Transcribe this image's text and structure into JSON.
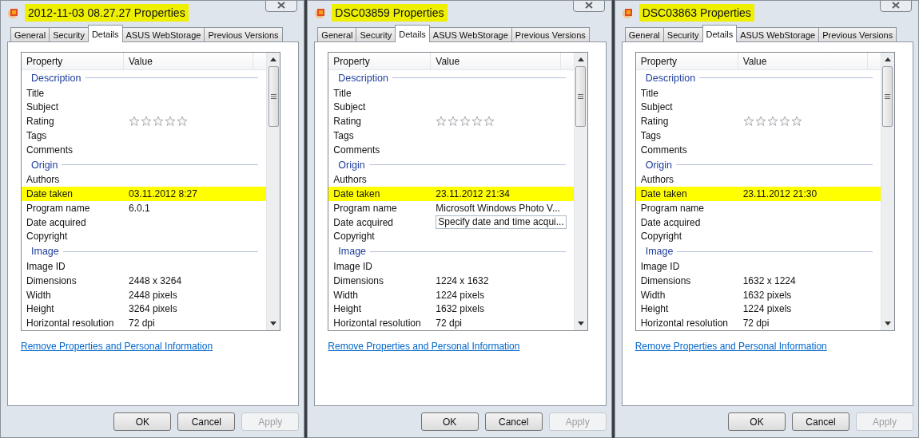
{
  "dialogs": [
    {
      "title": "2012-11-03 08.27.27 Properties",
      "title_highlighted": true,
      "tabs": [
        {
          "label": "General",
          "selected": false
        },
        {
          "label": "Security",
          "selected": false
        },
        {
          "label": "Details",
          "selected": true
        },
        {
          "label": "ASUS WebStorage",
          "selected": false
        },
        {
          "label": "Previous Versions",
          "selected": false
        }
      ],
      "columns": [
        "Property",
        "Value"
      ],
      "rows": [
        {
          "kind": "section",
          "name": "Description"
        },
        {
          "kind": "property",
          "name": "Title"
        },
        {
          "kind": "property",
          "name": "Subject"
        },
        {
          "kind": "rating",
          "name": "Rating",
          "stars": 0
        },
        {
          "kind": "property",
          "name": "Tags"
        },
        {
          "kind": "property",
          "name": "Comments"
        },
        {
          "kind": "section",
          "name": "Origin"
        },
        {
          "kind": "property",
          "name": "Authors"
        },
        {
          "kind": "property",
          "name": "Date taken",
          "value": "03.11.2012 8:27",
          "highlighted": true
        },
        {
          "kind": "property",
          "name": "Program name",
          "value": "6.0.1"
        },
        {
          "kind": "property",
          "name": "Date acquired"
        },
        {
          "kind": "property",
          "name": "Copyright"
        },
        {
          "kind": "section",
          "name": "Image"
        },
        {
          "kind": "property",
          "name": "Image ID"
        },
        {
          "kind": "property",
          "name": "Dimensions",
          "value": "2448 x 3264"
        },
        {
          "kind": "property",
          "name": "Width",
          "value": "2448 pixels"
        },
        {
          "kind": "property",
          "name": "Height",
          "value": "3264 pixels"
        },
        {
          "kind": "property",
          "name": "Horizontal resolution",
          "value": "72 dpi"
        }
      ],
      "link": "Remove Properties and Personal Information",
      "buttons": [
        {
          "label": "OK",
          "disabled": false
        },
        {
          "label": "Cancel",
          "disabled": false
        },
        {
          "label": "Apply",
          "disabled": true
        }
      ]
    },
    {
      "title": "DSC03859 Properties",
      "title_highlighted": true,
      "tabs": [
        {
          "label": "General",
          "selected": false
        },
        {
          "label": "Security",
          "selected": false
        },
        {
          "label": "Details",
          "selected": true
        },
        {
          "label": "ASUS WebStorage",
          "selected": false
        },
        {
          "label": "Previous Versions",
          "selected": false
        }
      ],
      "columns": [
        "Property",
        "Value"
      ],
      "rows": [
        {
          "kind": "section",
          "name": "Description"
        },
        {
          "kind": "property",
          "name": "Title"
        },
        {
          "kind": "property",
          "name": "Subject"
        },
        {
          "kind": "rating",
          "name": "Rating",
          "stars": 0
        },
        {
          "kind": "property",
          "name": "Tags"
        },
        {
          "kind": "property",
          "name": "Comments"
        },
        {
          "kind": "section",
          "name": "Origin"
        },
        {
          "kind": "property",
          "name": "Authors"
        },
        {
          "kind": "property",
          "name": "Date taken",
          "value": "23.11.2012 21:34",
          "highlighted": true
        },
        {
          "kind": "property",
          "name": "Program name",
          "value": "Microsoft Windows Photo V..."
        },
        {
          "kind": "field",
          "name": "Date acquired",
          "value": "Specify date and time acqui..."
        },
        {
          "kind": "property",
          "name": "Copyright"
        },
        {
          "kind": "section",
          "name": "Image"
        },
        {
          "kind": "property",
          "name": "Image ID"
        },
        {
          "kind": "property",
          "name": "Dimensions",
          "value": "1224 x 1632"
        },
        {
          "kind": "property",
          "name": "Width",
          "value": "1224 pixels"
        },
        {
          "kind": "property",
          "name": "Height",
          "value": "1632 pixels"
        },
        {
          "kind": "property",
          "name": "Horizontal resolution",
          "value": "72 dpi"
        }
      ],
      "link": "Remove Properties and Personal Information",
      "buttons": [
        {
          "label": "OK",
          "disabled": false
        },
        {
          "label": "Cancel",
          "disabled": false
        },
        {
          "label": "Apply",
          "disabled": true
        }
      ]
    },
    {
      "title": "DSC03863 Properties",
      "title_highlighted": true,
      "tabs": [
        {
          "label": "General",
          "selected": false
        },
        {
          "label": "Security",
          "selected": false
        },
        {
          "label": "Details",
          "selected": true
        },
        {
          "label": "ASUS WebStorage",
          "selected": false
        },
        {
          "label": "Previous Versions",
          "selected": false
        }
      ],
      "columns": [
        "Property",
        "Value"
      ],
      "rows": [
        {
          "kind": "section",
          "name": "Description"
        },
        {
          "kind": "property",
          "name": "Title"
        },
        {
          "kind": "property",
          "name": "Subject"
        },
        {
          "kind": "rating",
          "name": "Rating",
          "stars": 0
        },
        {
          "kind": "property",
          "name": "Tags"
        },
        {
          "kind": "property",
          "name": "Comments"
        },
        {
          "kind": "section",
          "name": "Origin"
        },
        {
          "kind": "property",
          "name": "Authors"
        },
        {
          "kind": "property",
          "name": "Date taken",
          "value": "23.11.2012 21:30",
          "highlighted": true
        },
        {
          "kind": "property",
          "name": "Program name"
        },
        {
          "kind": "property",
          "name": "Date acquired"
        },
        {
          "kind": "property",
          "name": "Copyright"
        },
        {
          "kind": "section",
          "name": "Image"
        },
        {
          "kind": "property",
          "name": "Image ID"
        },
        {
          "kind": "property",
          "name": "Dimensions",
          "value": "1632 x 1224"
        },
        {
          "kind": "property",
          "name": "Width",
          "value": "1632 pixels"
        },
        {
          "kind": "property",
          "name": "Height",
          "value": "1224 pixels"
        },
        {
          "kind": "property",
          "name": "Horizontal resolution",
          "value": "72 dpi"
        }
      ],
      "link": "Remove Properties and Personal Information",
      "buttons": [
        {
          "label": "OK",
          "disabled": false
        },
        {
          "label": "Cancel",
          "disabled": false
        },
        {
          "label": "Apply",
          "disabled": true
        }
      ]
    }
  ]
}
